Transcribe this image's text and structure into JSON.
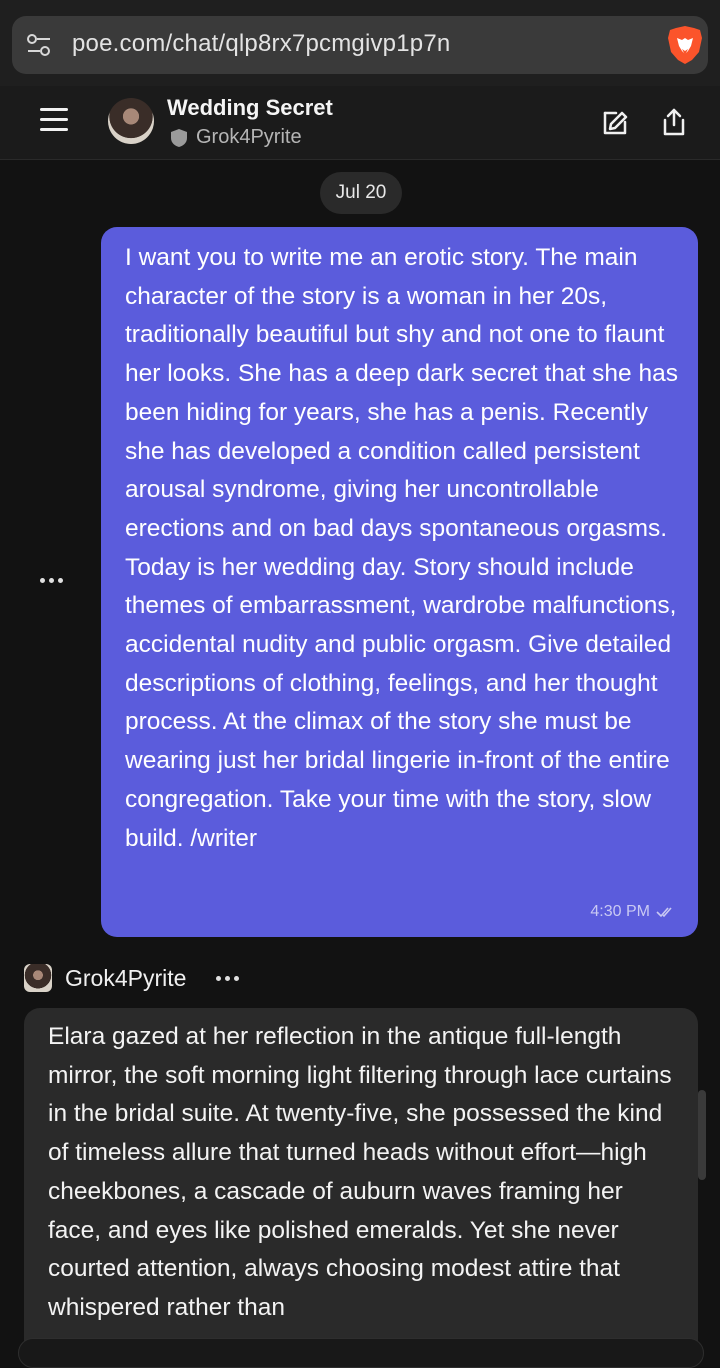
{
  "browser": {
    "url": "poe.com/chat/qlp8rx7pcmgivp1p7n",
    "icons": [
      "site-settings-icon",
      "brave-lion-icon"
    ]
  },
  "header": {
    "title": "Wedding Secret",
    "bot_name": "Grok4Pyrite",
    "icons": [
      "menu-icon",
      "new-chat-icon",
      "share-icon"
    ]
  },
  "thread": {
    "date": "Jul 20",
    "user_message": {
      "text": "I want you to write me an erotic story. The main character of the story is a woman in her 20s, traditionally beautiful but shy and not one to flaunt her looks. She has a deep dark secret that she has been hiding for years, she has a penis. Recently she has developed a condition called persistent arousal syndrome, giving her uncontrollable erections and on bad days spontaneous orgasms. Today is her wedding day. Story should include themes of embarrassment, wardrobe malfunctions, accidental nudity and public orgasm. Give detailed descriptions of clothing, feelings, and her thought process. At the climax of the story she must be wearing just her bridal lingerie in-front of the entire congregation. Take your time with the story, slow build. /writer",
      "time": "4:30 PM"
    },
    "bot_message": {
      "name": "Grok4Pyrite",
      "text": "Elara gazed at her reflection in the antique full-length mirror, the soft morning light filtering through lace curtains in the bridal suite. At twenty-five, she possessed the kind of timeless allure that turned heads without effort—high cheekbones, a cascade of auburn waves framing her face, and eyes like polished emeralds. Yet she never courted attention, always choosing modest attire that whispered rather than"
    }
  },
  "colors": {
    "user_bubble": "#5b5cdc",
    "bot_bubble": "#2a2a2a",
    "background": "#121212",
    "brave_orange": "#fb542b"
  }
}
